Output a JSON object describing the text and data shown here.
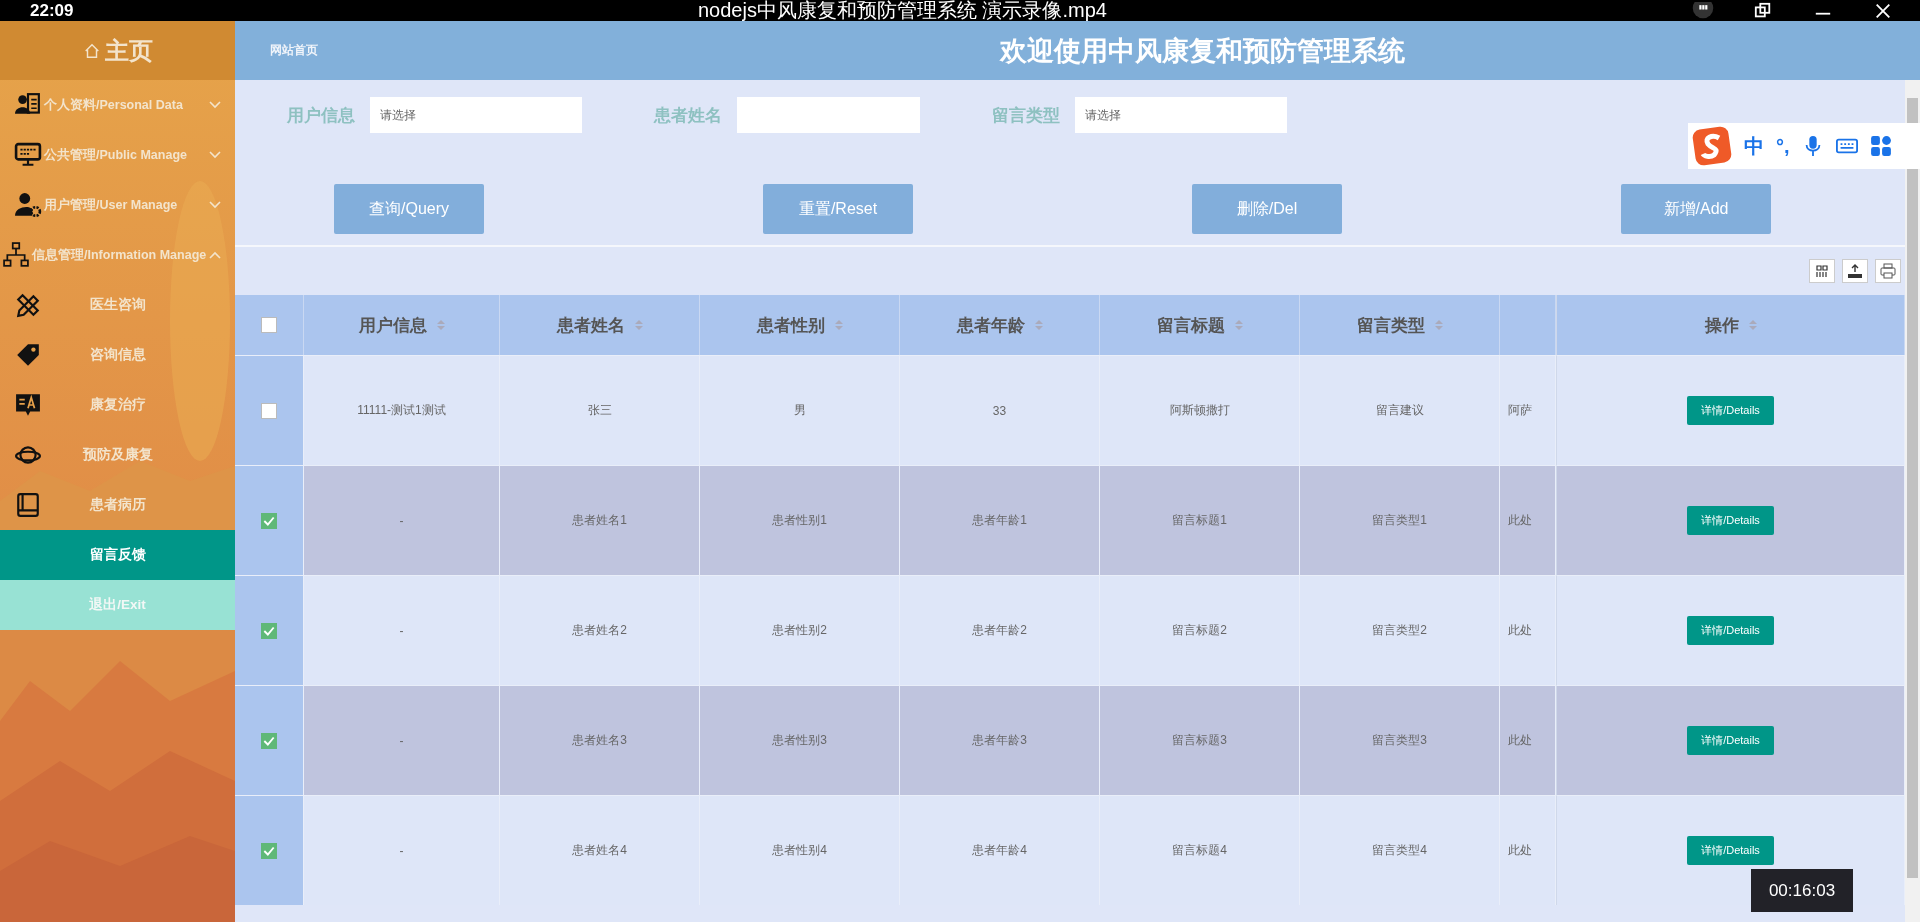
{
  "video_player": {
    "clock": "22:09",
    "title": "nodejs中风康复和预防管理系统 演示录像.mp4",
    "timestamp": "00:16:03"
  },
  "sidebar": {
    "home": "主页",
    "items": [
      {
        "label": "个人资料/Personal Data",
        "kind": "group",
        "expanded": false
      },
      {
        "label": "公共管理/Public Manage",
        "kind": "group",
        "expanded": false
      },
      {
        "label": "用户管理/User Manage",
        "kind": "group",
        "expanded": false
      },
      {
        "label": "信息管理/Information Manage",
        "kind": "group",
        "expanded": true,
        "children": [
          {
            "label": "医生咨询",
            "selected": false
          },
          {
            "label": "咨询信息",
            "selected": false
          },
          {
            "label": "康复治疗",
            "selected": false
          },
          {
            "label": "预防及康复",
            "selected": false
          },
          {
            "label": "患者病历",
            "selected": false
          },
          {
            "label": "留言反馈",
            "selected": true
          }
        ]
      },
      {
        "label": "退出/Exit",
        "kind": "exit"
      }
    ]
  },
  "header": {
    "breadcrumb": "网站首页",
    "title": "欢迎使用中风康复和预防管理系统"
  },
  "filters": [
    {
      "label": "用户信息",
      "placeholder": "请选择"
    },
    {
      "label": "患者姓名"
    },
    {
      "label": "留言类型",
      "placeholder": "请选择"
    }
  ],
  "buttons": [
    "查询/Query",
    "重置/Reset",
    "删除/Del",
    "新增/Add"
  ],
  "ime": {
    "mode": "中",
    "punctuation": "°,"
  },
  "table": {
    "select_all": false,
    "columns": [
      "用户信息",
      "患者姓名",
      "患者性别",
      "患者年龄",
      "留言标题",
      "留言类型"
    ],
    "actions_column": "操作",
    "rows": [
      {
        "selected": false,
        "cells": [
          "11111-测试1测试",
          "张三",
          "男",
          "33",
          "阿斯顿撒打",
          "留言建议"
        ],
        "column_7": "阿萨",
        "action": "详情/Details"
      },
      {
        "selected": true,
        "cells": [
          "-",
          "患者姓名1",
          "患者性别1",
          "患者年龄1",
          "留言标题1",
          "留言类型1"
        ],
        "column_7": "此处",
        "action": "详情/Details"
      },
      {
        "selected": true,
        "cells": [
          "-",
          "患者姓名2",
          "患者性别2",
          "患者年龄2",
          "留言标题2",
          "留言类型2"
        ],
        "column_7": "此处",
        "action": "详情/Details"
      },
      {
        "selected": true,
        "cells": [
          "-",
          "患者姓名3",
          "患者性别3",
          "患者年龄3",
          "留言标题3",
          "留言类型3"
        ],
        "column_7": "此处",
        "action": "详情/Details"
      },
      {
        "selected": true,
        "cells": [
          "-",
          "患者姓名4",
          "患者性别4",
          "患者年龄4",
          "留言标题4",
          "留言类型4"
        ],
        "column_7": "此处",
        "action": "详情/Details"
      }
    ]
  }
}
